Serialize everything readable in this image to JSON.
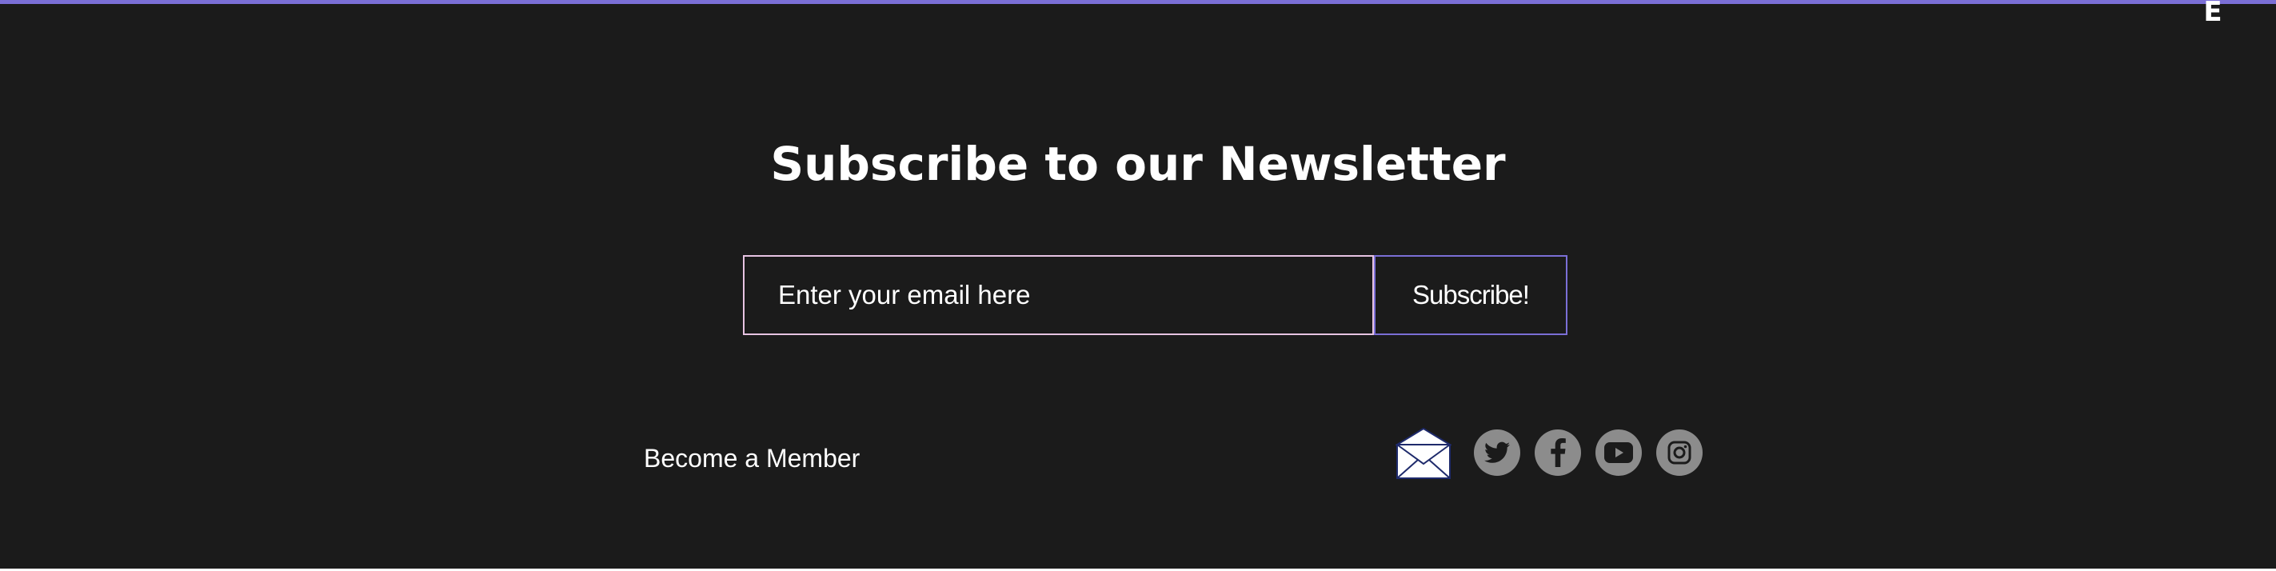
{
  "newsletter": {
    "title": "Subscribe to our Newsletter",
    "email_placeholder": "Enter your email here",
    "email_value": "",
    "subscribe_label": "Subscribe!"
  },
  "footer": {
    "member_link": "Become a Member",
    "corner_glyph": "E"
  },
  "social": {
    "icons": [
      "envelope-icon",
      "twitter-icon",
      "facebook-icon",
      "youtube-icon",
      "instagram-icon"
    ]
  },
  "colors": {
    "background": "#1b1b1b",
    "accent": "#7b6fd6",
    "input_border": "#e7c3e2",
    "social_circle": "#8c8c8c",
    "text": "#ffffff"
  }
}
